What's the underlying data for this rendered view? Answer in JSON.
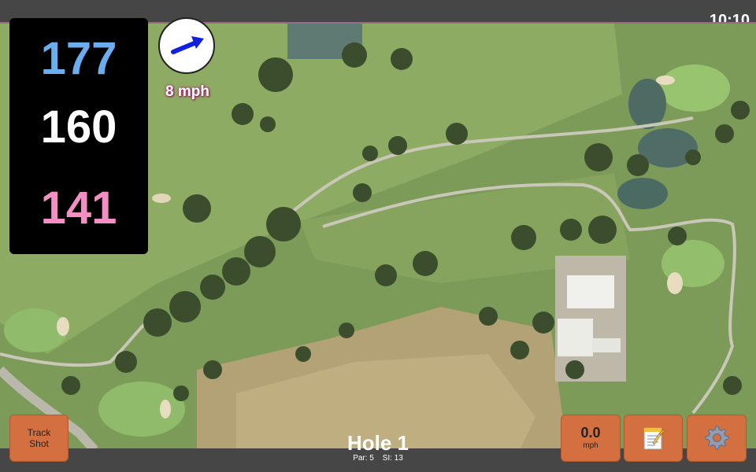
{
  "status": {
    "time": "10:10"
  },
  "distances": {
    "back": "177",
    "center": "160",
    "front": "141"
  },
  "wind": {
    "speed_label": "8 mph",
    "icon": "wind-arrow-icon"
  },
  "buttons": {
    "track_shot_line1": "Track",
    "track_shot_line2": "Shot",
    "speed_value": "0.0",
    "speed_unit": "mph",
    "notes_icon": "notepad-icon",
    "settings_icon": "gear-icon"
  },
  "hole": {
    "title": "Hole 1",
    "par": "Par: 5",
    "si": "SI: 13"
  },
  "colors": {
    "back": "#6aaef0",
    "center": "#ffffff",
    "front": "#f38fc2",
    "button": "#d4703f",
    "wind_arrow": "#1020e0"
  }
}
